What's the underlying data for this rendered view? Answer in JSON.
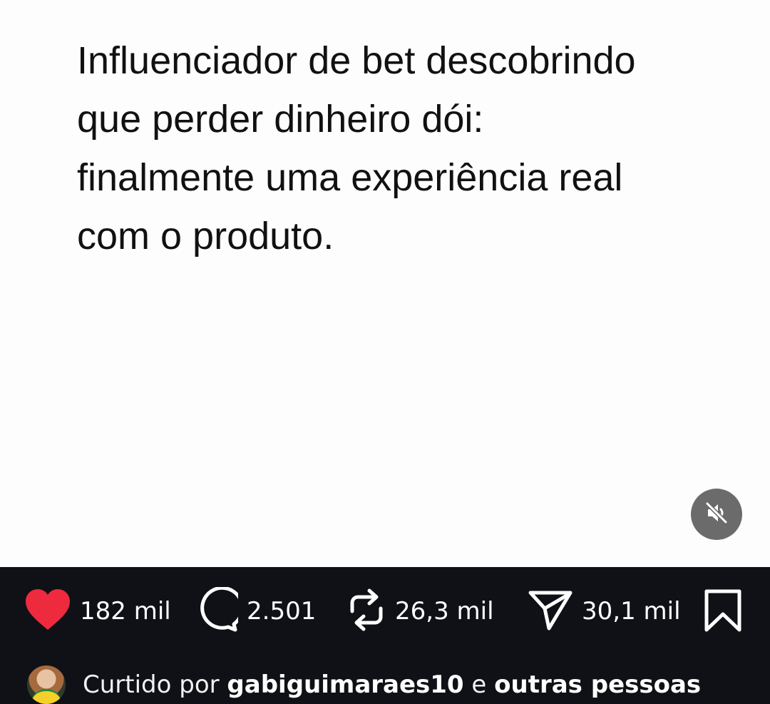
{
  "post": {
    "caption_lines": [
      "Influenciador de bet descobrindo",
      "que perder dinheiro dói:",
      "finalmente uma experiência real",
      "com o produto."
    ]
  },
  "controls": {
    "mute_icon": "speaker-muted-icon"
  },
  "actions": {
    "likes": "182 mil",
    "comments": "2.501",
    "reposts": "26,3 mil",
    "shares": "30,1 mil",
    "like_color": "#ee2a3f",
    "icons": [
      "heart-icon",
      "comment-bubble-icon",
      "repost-icon",
      "send-icon",
      "bookmark-icon"
    ]
  },
  "liked_by": {
    "prefix": "Curtido por",
    "user": "gabiguimaraes10",
    "connector": "e",
    "others": "outras pessoas"
  }
}
